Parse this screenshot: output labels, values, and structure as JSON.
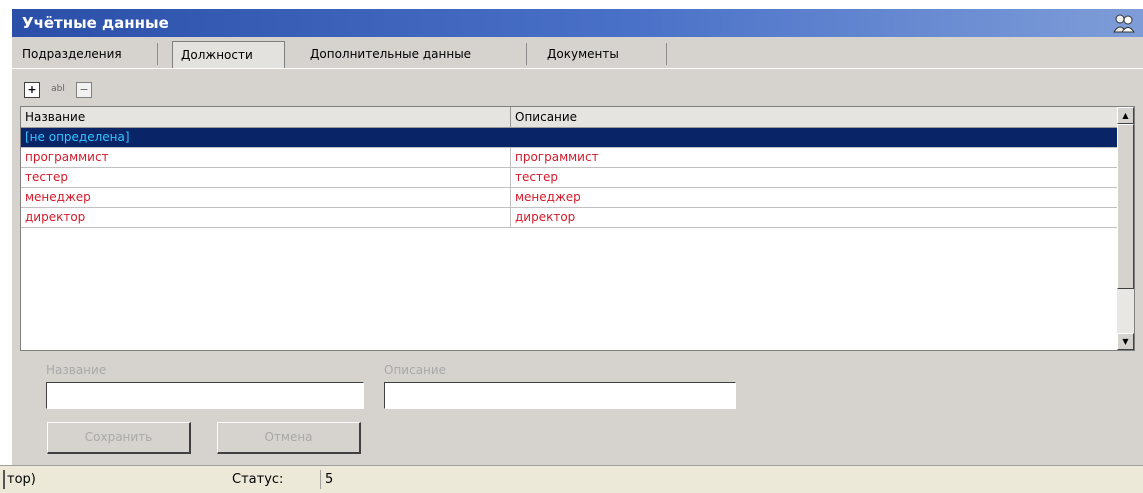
{
  "window": {
    "title": "Учётные данные"
  },
  "tabs": [
    {
      "label": "Подразделения"
    },
    {
      "label": "Должности"
    },
    {
      "label": "Дополнительные данные"
    },
    {
      "label": "Документы"
    }
  ],
  "active_tab": "Должности",
  "toolbar": {
    "add_symbol": "+",
    "edit_symbol": "abl",
    "delete_symbol": "−"
  },
  "grid": {
    "columns": [
      "Название",
      "Описание"
    ],
    "rows": [
      {
        "name": "[не определена]",
        "description": ""
      },
      {
        "name": "программист",
        "description": "программист"
      },
      {
        "name": "тестер",
        "description": "тестер"
      },
      {
        "name": "менеджер",
        "description": "менеджер"
      },
      {
        "name": "директор",
        "description": "директор"
      }
    ],
    "selected_row": 0,
    "scroll_up_glyph": "▲",
    "scroll_down_glyph": "▼"
  },
  "form": {
    "name_label": "Название",
    "name_value": "",
    "description_label": "Описание",
    "description_value": "",
    "save_label": "Сохранить",
    "cancel_label": "Отмена"
  },
  "statusbar": {
    "left_text": "тор)",
    "status_label": "Статус:",
    "status_value": "5"
  },
  "colors": {
    "title_gradient_start": "#2b4fa8",
    "selected_row_bg": "#0a2468",
    "selected_row_text": "#33c6ff",
    "row_text": "#d41a2a",
    "panel_bg": "#d6d3ce"
  }
}
